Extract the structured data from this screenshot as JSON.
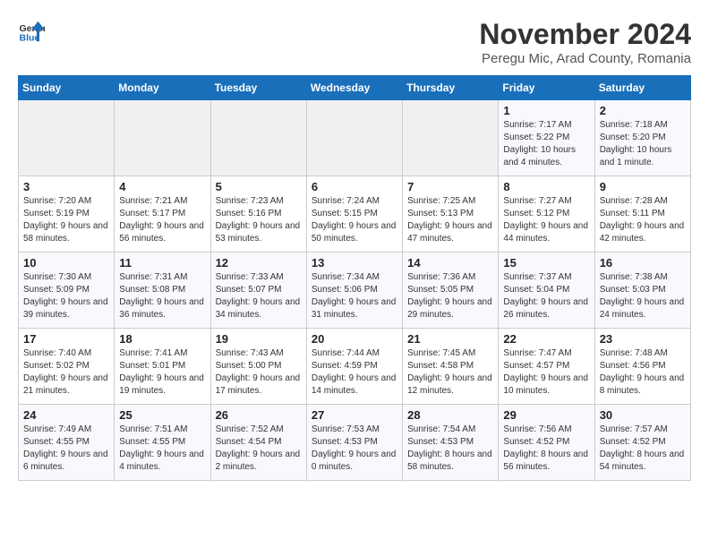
{
  "header": {
    "logo_line1": "General",
    "logo_line2": "Blue",
    "month_year": "November 2024",
    "location": "Peregu Mic, Arad County, Romania"
  },
  "weekdays": [
    "Sunday",
    "Monday",
    "Tuesday",
    "Wednesday",
    "Thursday",
    "Friday",
    "Saturday"
  ],
  "weeks": [
    [
      {
        "day": "",
        "info": ""
      },
      {
        "day": "",
        "info": ""
      },
      {
        "day": "",
        "info": ""
      },
      {
        "day": "",
        "info": ""
      },
      {
        "day": "",
        "info": ""
      },
      {
        "day": "1",
        "info": "Sunrise: 7:17 AM\nSunset: 5:22 PM\nDaylight: 10 hours and 4 minutes."
      },
      {
        "day": "2",
        "info": "Sunrise: 7:18 AM\nSunset: 5:20 PM\nDaylight: 10 hours and 1 minute."
      }
    ],
    [
      {
        "day": "3",
        "info": "Sunrise: 7:20 AM\nSunset: 5:19 PM\nDaylight: 9 hours and 58 minutes."
      },
      {
        "day": "4",
        "info": "Sunrise: 7:21 AM\nSunset: 5:17 PM\nDaylight: 9 hours and 56 minutes."
      },
      {
        "day": "5",
        "info": "Sunrise: 7:23 AM\nSunset: 5:16 PM\nDaylight: 9 hours and 53 minutes."
      },
      {
        "day": "6",
        "info": "Sunrise: 7:24 AM\nSunset: 5:15 PM\nDaylight: 9 hours and 50 minutes."
      },
      {
        "day": "7",
        "info": "Sunrise: 7:25 AM\nSunset: 5:13 PM\nDaylight: 9 hours and 47 minutes."
      },
      {
        "day": "8",
        "info": "Sunrise: 7:27 AM\nSunset: 5:12 PM\nDaylight: 9 hours and 44 minutes."
      },
      {
        "day": "9",
        "info": "Sunrise: 7:28 AM\nSunset: 5:11 PM\nDaylight: 9 hours and 42 minutes."
      }
    ],
    [
      {
        "day": "10",
        "info": "Sunrise: 7:30 AM\nSunset: 5:09 PM\nDaylight: 9 hours and 39 minutes."
      },
      {
        "day": "11",
        "info": "Sunrise: 7:31 AM\nSunset: 5:08 PM\nDaylight: 9 hours and 36 minutes."
      },
      {
        "day": "12",
        "info": "Sunrise: 7:33 AM\nSunset: 5:07 PM\nDaylight: 9 hours and 34 minutes."
      },
      {
        "day": "13",
        "info": "Sunrise: 7:34 AM\nSunset: 5:06 PM\nDaylight: 9 hours and 31 minutes."
      },
      {
        "day": "14",
        "info": "Sunrise: 7:36 AM\nSunset: 5:05 PM\nDaylight: 9 hours and 29 minutes."
      },
      {
        "day": "15",
        "info": "Sunrise: 7:37 AM\nSunset: 5:04 PM\nDaylight: 9 hours and 26 minutes."
      },
      {
        "day": "16",
        "info": "Sunrise: 7:38 AM\nSunset: 5:03 PM\nDaylight: 9 hours and 24 minutes."
      }
    ],
    [
      {
        "day": "17",
        "info": "Sunrise: 7:40 AM\nSunset: 5:02 PM\nDaylight: 9 hours and 21 minutes."
      },
      {
        "day": "18",
        "info": "Sunrise: 7:41 AM\nSunset: 5:01 PM\nDaylight: 9 hours and 19 minutes."
      },
      {
        "day": "19",
        "info": "Sunrise: 7:43 AM\nSunset: 5:00 PM\nDaylight: 9 hours and 17 minutes."
      },
      {
        "day": "20",
        "info": "Sunrise: 7:44 AM\nSunset: 4:59 PM\nDaylight: 9 hours and 14 minutes."
      },
      {
        "day": "21",
        "info": "Sunrise: 7:45 AM\nSunset: 4:58 PM\nDaylight: 9 hours and 12 minutes."
      },
      {
        "day": "22",
        "info": "Sunrise: 7:47 AM\nSunset: 4:57 PM\nDaylight: 9 hours and 10 minutes."
      },
      {
        "day": "23",
        "info": "Sunrise: 7:48 AM\nSunset: 4:56 PM\nDaylight: 9 hours and 8 minutes."
      }
    ],
    [
      {
        "day": "24",
        "info": "Sunrise: 7:49 AM\nSunset: 4:55 PM\nDaylight: 9 hours and 6 minutes."
      },
      {
        "day": "25",
        "info": "Sunrise: 7:51 AM\nSunset: 4:55 PM\nDaylight: 9 hours and 4 minutes."
      },
      {
        "day": "26",
        "info": "Sunrise: 7:52 AM\nSunset: 4:54 PM\nDaylight: 9 hours and 2 minutes."
      },
      {
        "day": "27",
        "info": "Sunrise: 7:53 AM\nSunset: 4:53 PM\nDaylight: 9 hours and 0 minutes."
      },
      {
        "day": "28",
        "info": "Sunrise: 7:54 AM\nSunset: 4:53 PM\nDaylight: 8 hours and 58 minutes."
      },
      {
        "day": "29",
        "info": "Sunrise: 7:56 AM\nSunset: 4:52 PM\nDaylight: 8 hours and 56 minutes."
      },
      {
        "day": "30",
        "info": "Sunrise: 7:57 AM\nSunset: 4:52 PM\nDaylight: 8 hours and 54 minutes."
      }
    ]
  ]
}
